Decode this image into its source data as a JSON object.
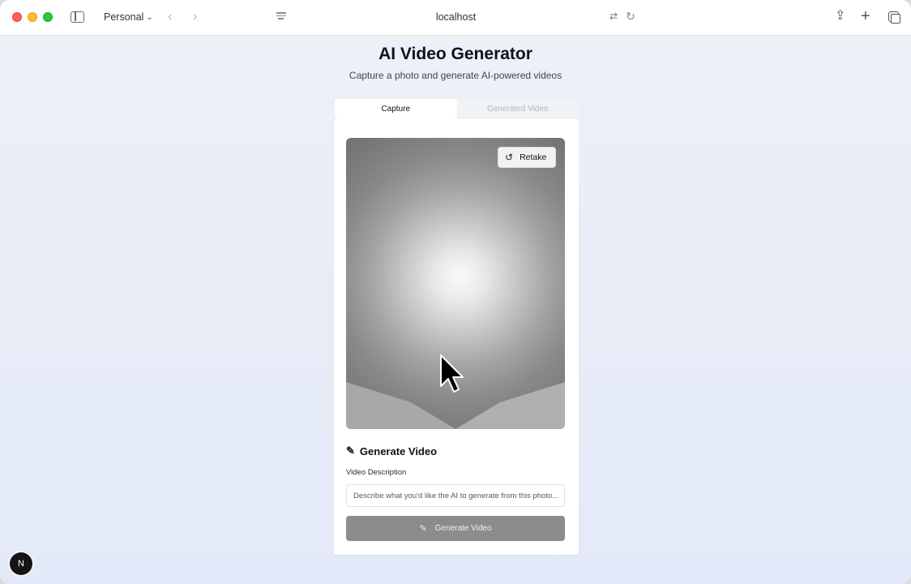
{
  "browser": {
    "profile": "Personal",
    "address": "localhost"
  },
  "page": {
    "title": "AI Video Generator",
    "subtitle": "Capture a photo and generate AI-powered videos",
    "tabs": [
      {
        "label": "Capture",
        "active": true
      },
      {
        "label": "Generated Video",
        "active": false
      }
    ],
    "photo": {
      "retake_label": "Retake"
    },
    "generate": {
      "heading": "Generate Video",
      "description_label": "Video Description",
      "description_placeholder": "Describe what you'd like the AI to generate from this photo...",
      "description_value": "",
      "button_label": "Generate Video"
    }
  },
  "dev_badge": "N",
  "colors": {
    "button_disabled": "#8c8c8c",
    "traffic_red": "#ff5f57",
    "traffic_yellow": "#febc2e",
    "traffic_green": "#28c840"
  },
  "icons": [
    "sidebar-icon",
    "chevron-down-icon",
    "back-icon",
    "forward-icon",
    "reader-icon",
    "translate-icon",
    "reload-icon",
    "share-icon",
    "plus-icon",
    "tabs-icon",
    "retake-icon",
    "wand-icon",
    "cursor-icon"
  ]
}
